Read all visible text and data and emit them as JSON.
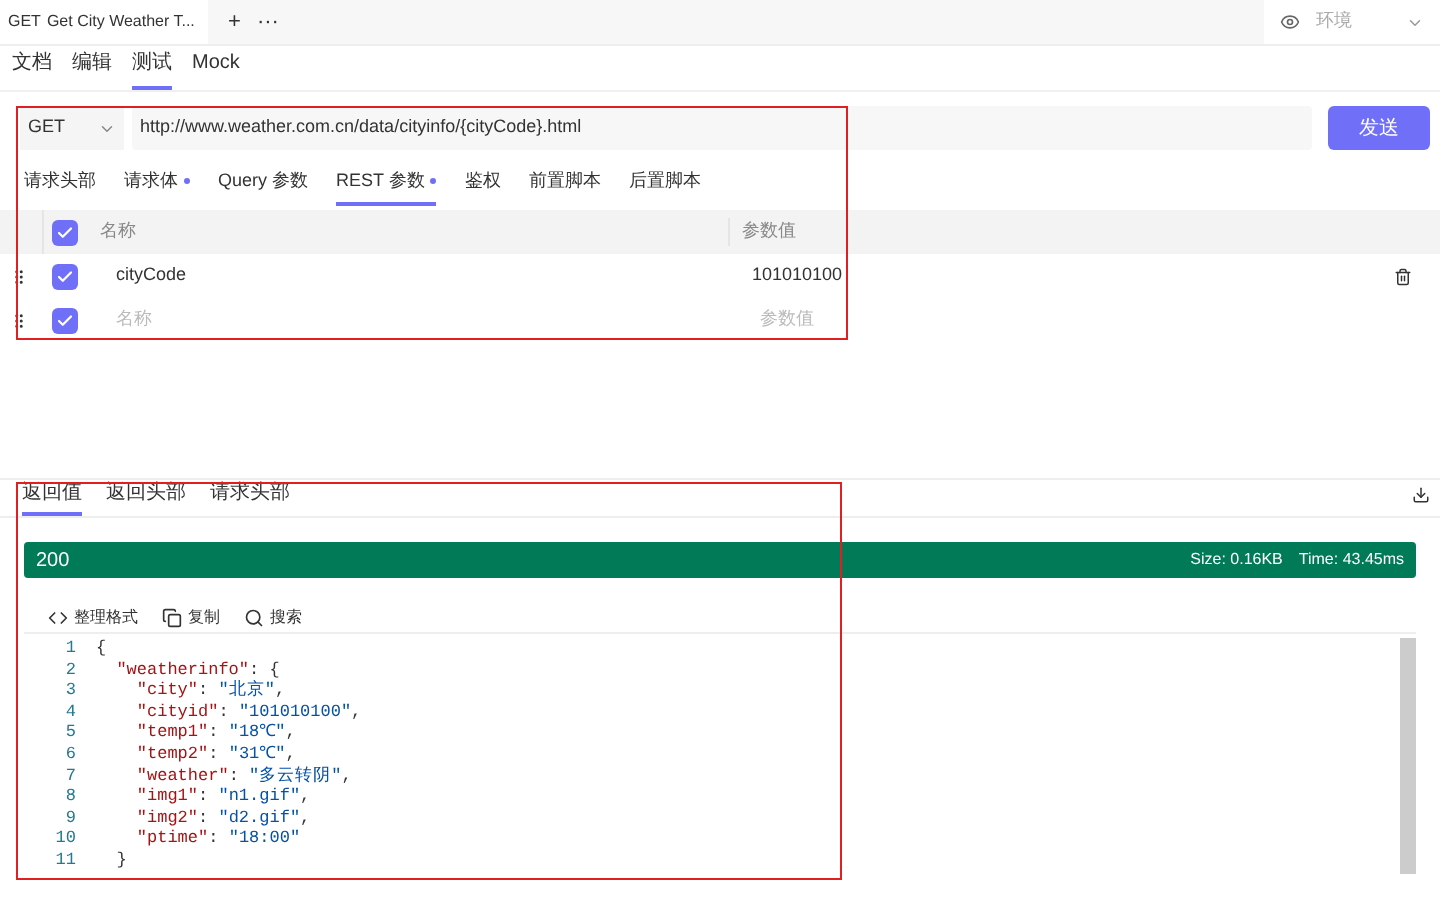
{
  "doc_tabs": [
    {
      "method": "GET",
      "title": "Get City Weather T...",
      "selected": true
    }
  ],
  "doc_tab_actions": [
    "+",
    "···"
  ],
  "environment": {
    "placeholder": "环境"
  },
  "mode_tabs": [
    {
      "label": "文档",
      "selected": false
    },
    {
      "label": "编辑",
      "selected": false
    },
    {
      "label": "测试",
      "selected": true
    },
    {
      "label": "Mock",
      "selected": false
    }
  ],
  "request": {
    "method": "GET",
    "url": "http://www.weather.com.cn/data/cityinfo/{cityCode}.html",
    "send": "发送"
  },
  "param_tabs": [
    {
      "label": "请求头部",
      "selected": false,
      "dot": false
    },
    {
      "label": "请求体",
      "selected": false,
      "dot": true
    },
    {
      "label": "Query 参数",
      "selected": false,
      "dot": false
    },
    {
      "label": "REST 参数",
      "selected": true,
      "dot": true
    },
    {
      "label": "鉴权",
      "selected": false,
      "dot": false
    },
    {
      "label": "前置脚本",
      "selected": false,
      "dot": false
    },
    {
      "label": "后置脚本",
      "selected": false,
      "dot": false
    }
  ],
  "params_table": {
    "all_checked": true,
    "columns": [
      "名称",
      "参数值"
    ],
    "rows": [
      {
        "checked": true,
        "name": "cityCode",
        "value": "101010100"
      }
    ],
    "new_row": {
      "checked": true,
      "name_placeholder": "名称",
      "value_placeholder": "参数值"
    }
  },
  "response_tabs": [
    {
      "label": "返回值",
      "selected": true
    },
    {
      "label": "返回头部",
      "selected": false
    },
    {
      "label": "请求头部",
      "selected": false
    }
  ],
  "status": {
    "code": "200",
    "size": "Size: 0.16KB",
    "time": "Time: 43.45ms"
  },
  "toolbar": [
    {
      "kind": "format",
      "label": "整理格式"
    },
    {
      "kind": "copy",
      "label": "复制"
    },
    {
      "kind": "search",
      "label": "搜索"
    }
  ],
  "code_lines": [
    {
      "number": "1",
      "text": "{"
    },
    {
      "number": "2",
      "text": "  \"weatherinfo\": {"
    },
    {
      "number": "3",
      "text": "    \"city\": \"北京\","
    },
    {
      "number": "4",
      "text": "    \"cityid\": \"101010100\","
    },
    {
      "number": "5",
      "text": "    \"temp1\": \"18℃\","
    },
    {
      "number": "6",
      "text": "    \"temp2\": \"31℃\","
    },
    {
      "number": "7",
      "text": "    \"weather\": \"多云转阴\","
    },
    {
      "number": "8",
      "text": "    \"img1\": \"n1.gif\","
    },
    {
      "number": "9",
      "text": "    \"img2\": \"d2.gif\","
    },
    {
      "number": "10",
      "text": "    \"ptime\": \"18:00\""
    },
    {
      "number": "11",
      "text": "  }"
    }
  ]
}
